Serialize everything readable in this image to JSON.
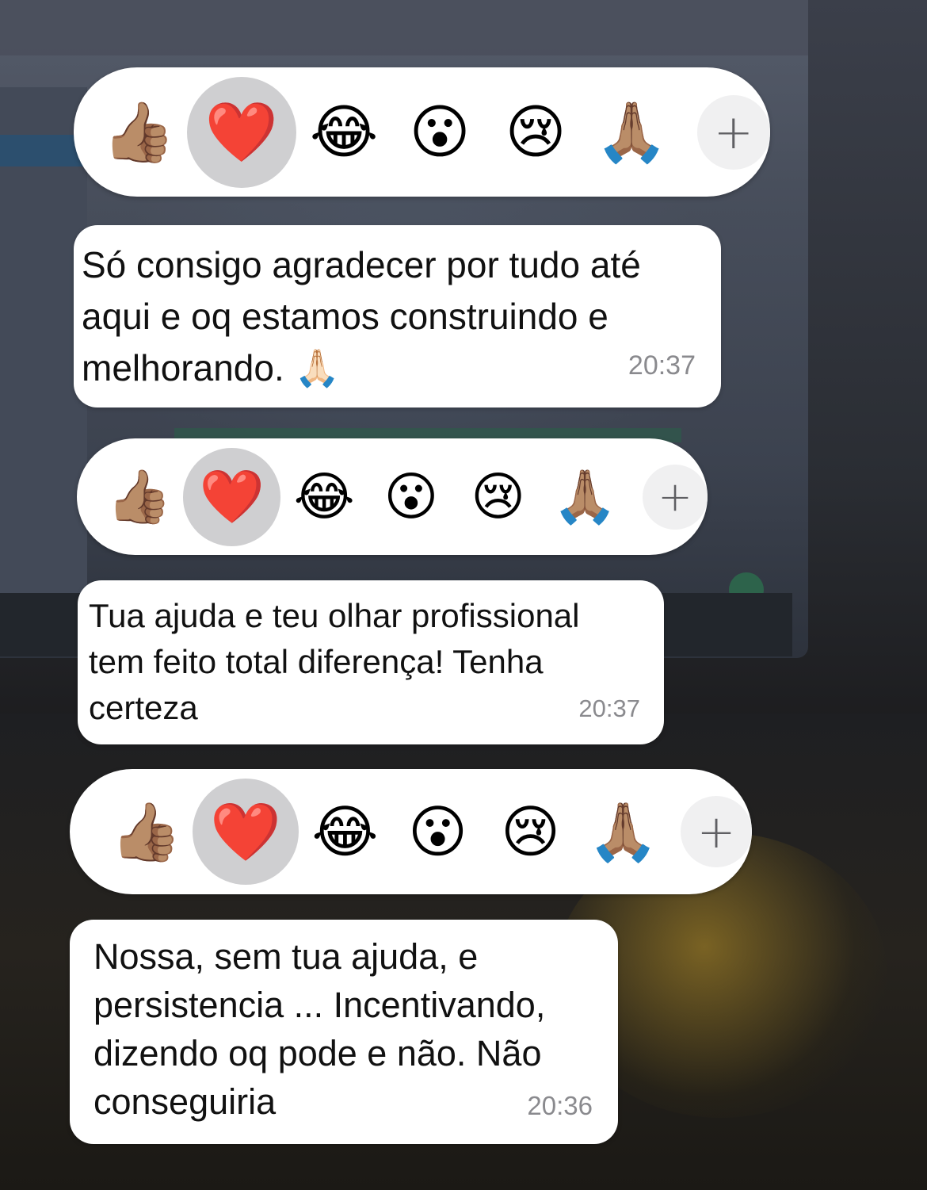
{
  "reaction_options": {
    "thumbs_up": "👍🏽",
    "heart": "❤️",
    "laughing": "😂",
    "surprised": "😮",
    "crying": "😢",
    "pray": "🙏🏽",
    "more": "+"
  },
  "messages": [
    {
      "text": "Só consigo agradecer por tudo até aqui e oq estamos construindo e melhorando. 🙏🏻",
      "time": "20:37"
    },
    {
      "text": "Tua ajuda e teu olhar profissional tem feito total diferença! Tenha certeza",
      "time": "20:37"
    },
    {
      "text": "Nossa, sem tua ajuda, e persistencia ... Incentivando, dizendo oq pode e não. Não conseguiria",
      "time": "20:36"
    }
  ],
  "selected_reaction": "heart",
  "colors": {
    "bubble": "#ffffff",
    "selected_highlight": "#cfcfd1",
    "timestamp": "#8a8a8e"
  }
}
